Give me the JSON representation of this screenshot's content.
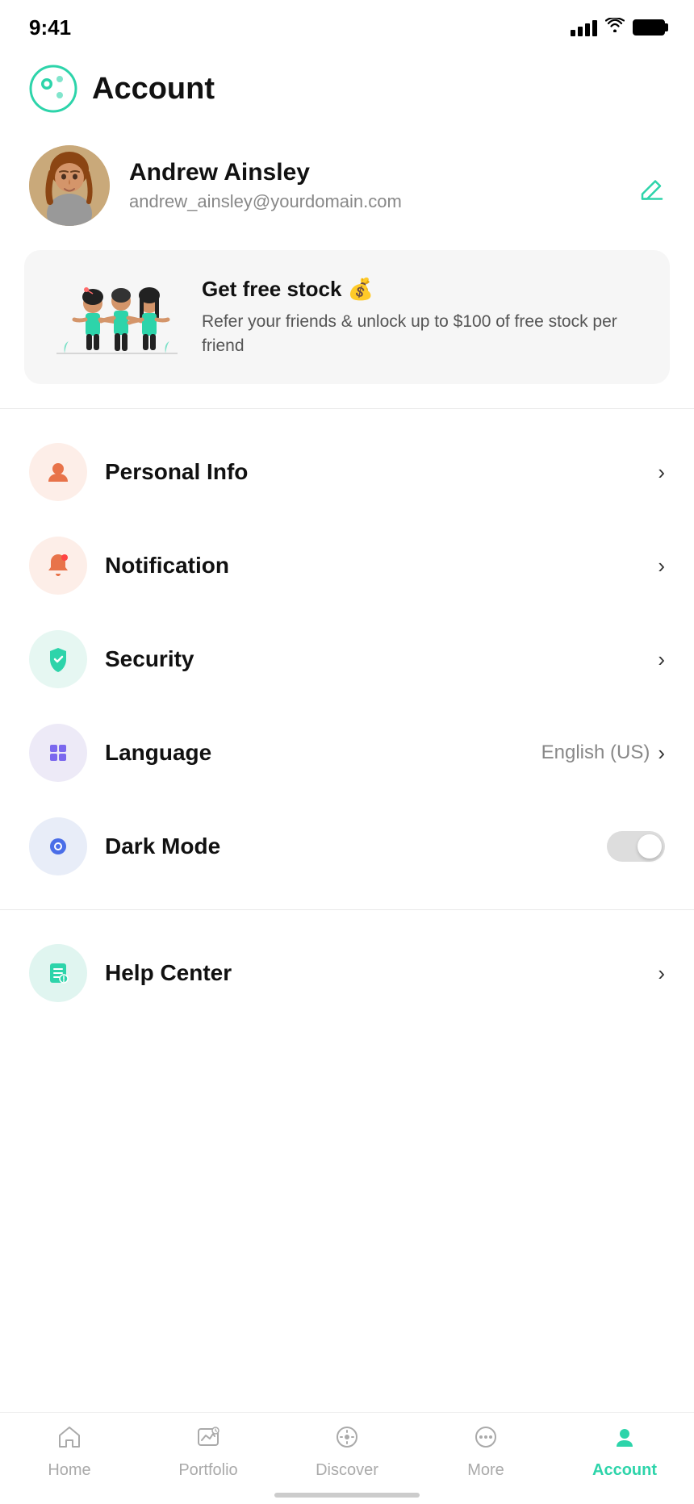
{
  "statusBar": {
    "time": "9:41"
  },
  "header": {
    "title": "Account"
  },
  "profile": {
    "name": "Andrew Ainsley",
    "email": "andrew_ainsley@yourdomain.com",
    "editLabel": "Edit"
  },
  "referral": {
    "title": "Get free stock 💰",
    "description": "Refer your friends & unlock up to $100 of free stock per friend"
  },
  "menuItems": [
    {
      "id": "personal-info",
      "label": "Personal Info",
      "iconColor": "orange",
      "hasChevron": true,
      "value": ""
    },
    {
      "id": "notification",
      "label": "Notification",
      "iconColor": "orange",
      "hasChevron": true,
      "value": ""
    },
    {
      "id": "security",
      "label": "Security",
      "iconColor": "green",
      "hasChevron": true,
      "value": ""
    },
    {
      "id": "language",
      "label": "Language",
      "iconColor": "purple",
      "hasChevron": true,
      "value": "English (US)"
    },
    {
      "id": "dark-mode",
      "label": "Dark Mode",
      "iconColor": "blue",
      "hasChevron": false,
      "value": ""
    },
    {
      "id": "help-center",
      "label": "Help Center",
      "iconColor": "teal",
      "hasChevron": true,
      "value": ""
    }
  ],
  "bottomNav": [
    {
      "id": "home",
      "label": "Home",
      "active": false
    },
    {
      "id": "portfolio",
      "label": "Portfolio",
      "active": false
    },
    {
      "id": "discover",
      "label": "Discover",
      "active": false
    },
    {
      "id": "more",
      "label": "More",
      "active": false
    },
    {
      "id": "account",
      "label": "Account",
      "active": true
    }
  ],
  "colors": {
    "accent": "#2dd4aa",
    "orange": "#e8734a",
    "orangeLight": "#fdeee8",
    "green": "#2dd4aa",
    "greenLight": "#e6f7f2",
    "purple": "#7b68ee",
    "purpleLight": "#edeaf7",
    "blue": "#4a6ee8",
    "blueLight": "#e8edf8",
    "tealLight": "#e0f5f0"
  }
}
